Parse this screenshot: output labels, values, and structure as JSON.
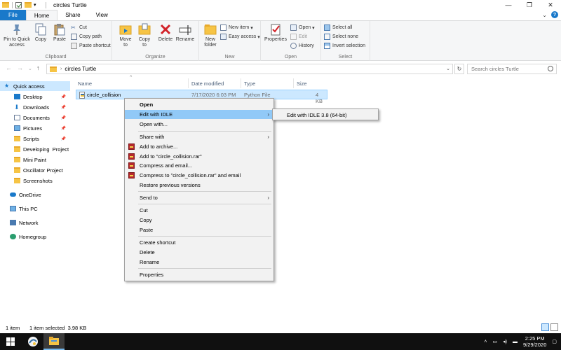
{
  "window": {
    "title": "circles Turtle",
    "controls": [
      "—",
      "❐",
      "✕"
    ]
  },
  "ribbon_tabs": [
    "File",
    "Home",
    "Share",
    "View"
  ],
  "ribbon": {
    "clipboard": {
      "label": "Clipboard",
      "pin": "Pin to Quick access",
      "copy": "Copy",
      "paste": "Paste",
      "cut": "Cut",
      "copy_path": "Copy path",
      "paste_shortcut": "Paste shortcut"
    },
    "organize": {
      "label": "Organize",
      "move_to": "Move to",
      "copy_to": "Copy to",
      "delete": "Delete",
      "rename": "Rename"
    },
    "new": {
      "label": "New",
      "new_folder": "New folder",
      "new_item": "New item",
      "easy_access": "Easy access"
    },
    "open": {
      "label": "Open",
      "properties": "Properties",
      "open": "Open",
      "edit": "Edit",
      "history": "History"
    },
    "select": {
      "label": "Select",
      "select_all": "Select all",
      "select_none": "Select none",
      "invert": "Invert selection"
    }
  },
  "address": {
    "crumb": "circles Turtle",
    "search_placeholder": "Search circles Turtle"
  },
  "nav_pane": {
    "quick_access": "Quick access",
    "items": [
      "Desktop",
      "Downloads",
      "Documents",
      "Pictures",
      "Scripts",
      "Developing  Project",
      "Mini Paint",
      "Oscillator Project",
      "Screenshots"
    ],
    "onedrive": "OneDrive",
    "this_pc": "This PC",
    "network": "Network",
    "homegroup": "Homegroup"
  },
  "columns": [
    "Name",
    "Date modified",
    "Type",
    "Size"
  ],
  "file": {
    "name": "circle_collision",
    "date": "7/17/2020 6:03 PM",
    "type": "Python File",
    "size": "4 KB"
  },
  "context_menu": {
    "open": "Open",
    "edit_idle": "Edit with IDLE",
    "open_with": "Open with...",
    "share_with": "Share with",
    "add_archive": "Add to archive...",
    "add_rar": "Add to \"circle_collision.rar\"",
    "compress_email": "Compress and email...",
    "compress_rar_email": "Compress to \"circle_collision.rar\" and email",
    "restore": "Restore previous versions",
    "send_to": "Send to",
    "cut": "Cut",
    "copy": "Copy",
    "paste": "Paste",
    "create_shortcut": "Create shortcut",
    "delete": "Delete",
    "rename": "Rename",
    "properties": "Properties"
  },
  "submenu": {
    "idle38": "Edit with IDLE 3.8 (64-bit)"
  },
  "status": {
    "count": "1 item",
    "selected": "1 item selected  3.98 KB"
  },
  "taskbar": {
    "time": "2:25 PM",
    "date": "9/29/2020"
  }
}
